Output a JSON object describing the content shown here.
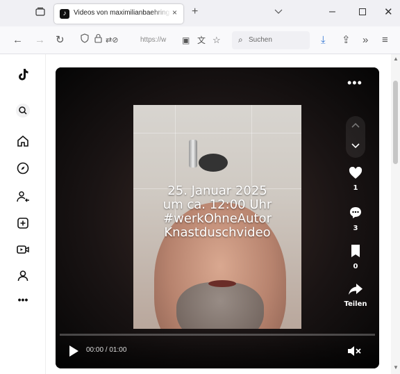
{
  "browser": {
    "tab_title": "Videos von maximilianbaehring",
    "tab_close": "×",
    "new_tab": "+",
    "url_text": "https://w",
    "search_placeholder": "Suchen"
  },
  "video": {
    "overlay_lines": [
      "25. Januar 2025",
      "um ca. 12:00 Uhr",
      "#werkOhneAutor",
      "Knastduschvideo"
    ],
    "time_current": "00:00",
    "time_total": "01:00",
    "progress": 0,
    "actions": {
      "likes": "1",
      "comments": "3",
      "saves": "0",
      "share_label": "Teilen"
    },
    "more_label": "•••"
  },
  "sidebar": {
    "items": [
      "tiktok-logo",
      "search-icon",
      "home-icon",
      "explore-icon",
      "following-icon",
      "upload-icon",
      "live-icon",
      "profile-icon",
      "more-icon"
    ],
    "more_label": "•••"
  }
}
